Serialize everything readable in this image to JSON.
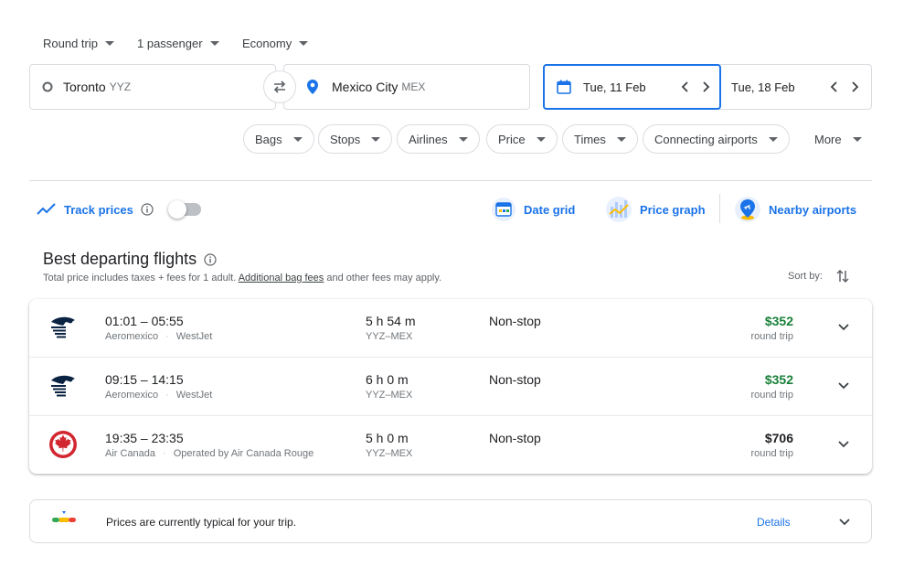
{
  "trip_options": {
    "trip_type": "Round trip",
    "passengers": "1 passenger",
    "cabin": "Economy"
  },
  "search": {
    "origin_city": "Toronto",
    "origin_code": "YYZ",
    "destination_city": "Mexico City",
    "destination_code": "MEX",
    "depart_date": "Tue, 11 Feb",
    "return_date": "Tue, 18 Feb"
  },
  "filters": [
    "Bags",
    "Stops",
    "Airlines",
    "Price",
    "Times",
    "Connecting airports",
    "More"
  ],
  "tools": {
    "track_prices": "Track prices",
    "date_grid": "Date grid",
    "price_graph": "Price graph",
    "nearby_airports": "Nearby airports"
  },
  "results": {
    "heading": "Best departing flights",
    "subtext_before": "Total price includes taxes + fees for 1 adult.",
    "bag_fees_link": "Additional bag fees",
    "subtext_after": "and other fees may apply.",
    "sort_label": "Sort by:"
  },
  "flights": [
    {
      "times": "01:01 – 05:55",
      "airline": "Aeromexico",
      "partner": "WestJet",
      "duration": "5 h 54 m",
      "route": "YYZ–MEX",
      "stops": "Non-stop",
      "price": "$352",
      "price_note": "round trip",
      "price_color": "#188038",
      "logo": "aeromexico-logo"
    },
    {
      "times": "09:15 – 14:15",
      "airline": "Aeromexico",
      "partner": "WestJet",
      "duration": "6 h 0 m",
      "route": "YYZ–MEX",
      "stops": "Non-stop",
      "price": "$352",
      "price_note": "round trip",
      "price_color": "#188038",
      "logo": "aeromexico-logo"
    },
    {
      "times": "19:35 – 23:35",
      "airline": "Air Canada",
      "partner": "Operated by Air Canada Rouge",
      "duration": "5 h 0 m",
      "route": "YYZ–MEX",
      "stops": "Non-stop",
      "price": "$706",
      "price_note": "round trip",
      "price_color": "#202124",
      "logo": "air-canada-logo"
    }
  ],
  "price_insight": {
    "text": "Prices are currently typical for your trip.",
    "details": "Details"
  },
  "colors": {
    "accent": "#1a73e8",
    "good_price": "#188038",
    "text": "#202124",
    "muted": "#70757a"
  }
}
